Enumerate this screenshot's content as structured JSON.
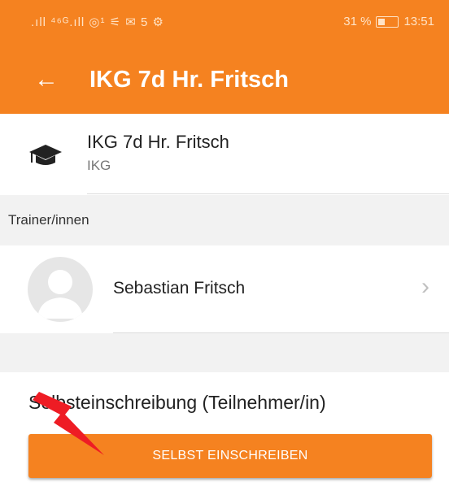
{
  "status_bar": {
    "signal_text": ".ıll ⁴⁶ᴳ.ıll ◎¹ ⚟ ✉ 5 ⚙",
    "battery": "31 %",
    "time": "13:51"
  },
  "app_bar": {
    "back_icon": "arrow-left-icon",
    "title": "IKG 7d Hr. Fritsch"
  },
  "course": {
    "icon": "graduation-cap-icon",
    "name": "IKG 7d Hr. Fritsch",
    "subtitle": "IKG"
  },
  "trainers": {
    "header": "Trainer/innen",
    "items": [
      {
        "name": "Sebastian Fritsch",
        "avatar_icon": "avatar-placeholder-icon",
        "chevron_icon": "chevron-right-icon"
      }
    ]
  },
  "enrollment": {
    "label": "Selbsteinschreibung (Teilnehmer/in)",
    "button_label": "SELBST EINSCHREIBEN"
  },
  "colors": {
    "accent": "#f58220",
    "section_bg": "#f2f2f2",
    "annotation_red": "#ee1c24"
  }
}
